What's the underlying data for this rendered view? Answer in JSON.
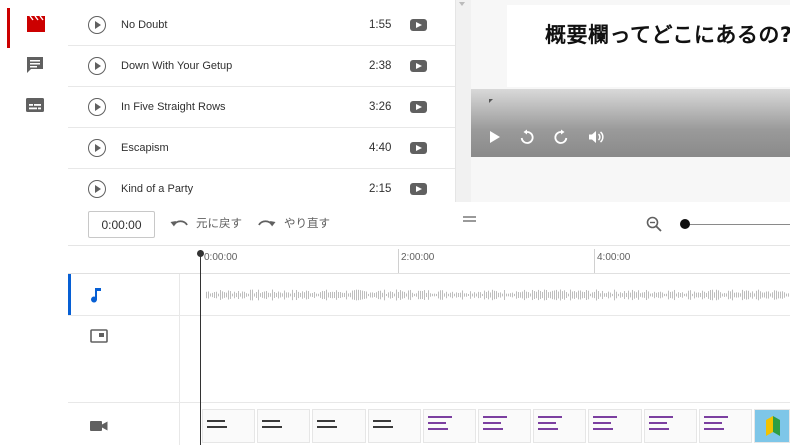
{
  "rail": {
    "items": [
      {
        "name": "editor",
        "icon": "clapperboard-icon",
        "active": true
      },
      {
        "name": "comments",
        "icon": "comment-icon",
        "active": false
      },
      {
        "name": "subtitles",
        "icon": "subtitles-icon",
        "active": false
      }
    ],
    "accent_color": "#cc0000"
  },
  "tracks": [
    {
      "title": "No Doubt",
      "duration": "1:55"
    },
    {
      "title": "Down With Your Getup",
      "duration": "2:38"
    },
    {
      "title": "In Five Straight Rows",
      "duration": "3:26"
    },
    {
      "title": "Escapism",
      "duration": "4:40"
    },
    {
      "title": "Kind of a Party",
      "duration": "2:15"
    }
  ],
  "preview": {
    "title": "概要欄ってどこにあるの?"
  },
  "toolbar": {
    "timecode": "0:00:00",
    "undo_label": "元に戻す",
    "redo_label": "やり直す"
  },
  "timeline": {
    "ticks": [
      "0:00:00",
      "2:00:00",
      "4:00:00"
    ],
    "lanes": [
      {
        "name": "audio",
        "icon": "music-note-icon"
      },
      {
        "name": "end-screen",
        "icon": "end-screen-icon"
      },
      {
        "name": "video",
        "icon": "video-camera-icon"
      }
    ]
  }
}
